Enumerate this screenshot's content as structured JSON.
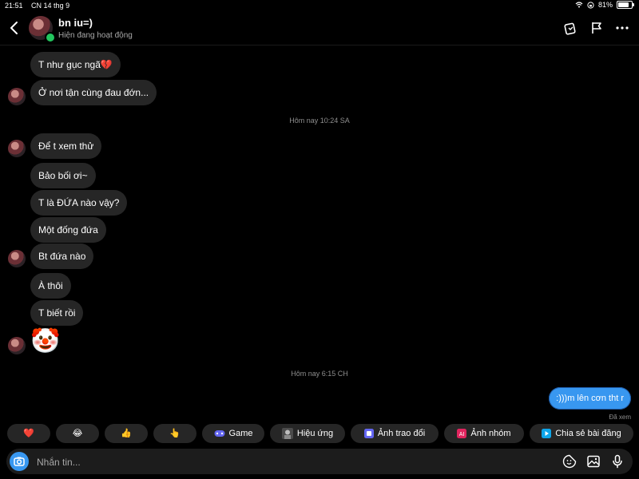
{
  "status": {
    "time": "21:51",
    "date": "CN 14 thg 9",
    "battery": "81%",
    "battery_level": 0.81
  },
  "header": {
    "title": "bn iu=)",
    "subtitle": "Hiện đang hoạt động"
  },
  "messages": [
    {
      "text": "T như gục ngã💔"
    },
    {
      "text": "Ở nơi tận cùng đau đớn..."
    },
    {
      "text": "Để t xem thử"
    },
    {
      "text": "Bảo bối ơi~"
    },
    {
      "text": "T là ĐỨA nào vậy?"
    },
    {
      "text": "Một đống đứa"
    },
    {
      "text": "Bt đứa nào"
    },
    {
      "text": "À thôi"
    },
    {
      "text": "T biết rồi"
    },
    {
      "emoji": "🤡"
    }
  ],
  "timestamps": [
    "Hôm nay 10:24 SA",
    "Hôm nay 6:15 CH"
  ],
  "outgoing": {
    "text": ":)))m lên cơn tht r",
    "seen": "Đã xem"
  },
  "quick": {
    "heart": "❤️",
    "laugh": "😂",
    "thumbs": "👍",
    "point": "👆",
    "game": "Game",
    "effects": "Hiệu ứng",
    "photo_swap": "Ảnh trao đổi",
    "group_photo": "Ảnh nhóm",
    "share_post": "Chia sẻ bài đăng"
  },
  "composer": {
    "placeholder": "Nhắn tin..."
  },
  "colors": {
    "accent": "#3897f0",
    "bubble_in": "#262626",
    "online": "#22c55e"
  }
}
